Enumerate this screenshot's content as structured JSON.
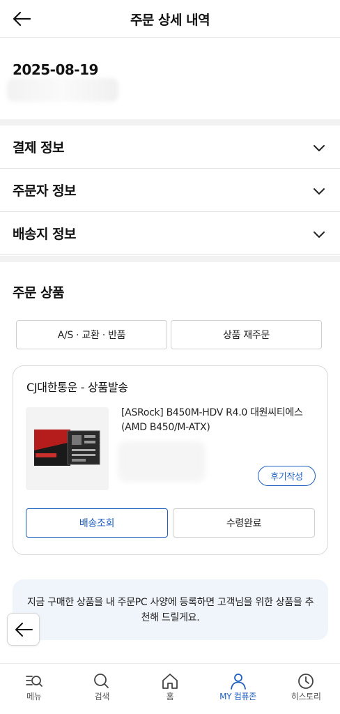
{
  "header": {
    "title": "주문 상세 내역",
    "back_icon": "arrow-left-icon"
  },
  "order": {
    "date": "2025-08-19"
  },
  "accordions": [
    {
      "label": "결제 정보"
    },
    {
      "label": "주문자 정보"
    },
    {
      "label": "배송지 정보"
    }
  ],
  "products_section": {
    "title": "주문 상품",
    "as_button": "A/S · 교환 · 반품",
    "reorder_button": "상품 재주문"
  },
  "shipment": {
    "status": "CJ대한통운 - 상품발송",
    "product_name": "[ASRock] B450M-HDV R4.0 대원씨티에스 (AMD B450/M-ATX)",
    "review_button": "후기작성",
    "track_button": "배송조회",
    "received_button": "수령완료"
  },
  "banner": {
    "text": "지금 구매한 상품을 내 주문PC 사양에 등록하면 고객님을 위한 상품을 추천해 드릴게요."
  },
  "tabbar": {
    "items": [
      {
        "label": "메뉴",
        "icon": "menu-search-icon"
      },
      {
        "label": "검색",
        "icon": "search-icon"
      },
      {
        "label": "홈",
        "icon": "home-icon"
      },
      {
        "label": "MY 컴퓨존",
        "icon": "user-icon",
        "active": true
      },
      {
        "label": "히스토리",
        "icon": "clock-icon"
      }
    ]
  },
  "colors": {
    "accent": "#1f5fbf",
    "divider": "#f2f2f2",
    "banner_bg": "#f0f5fb"
  }
}
